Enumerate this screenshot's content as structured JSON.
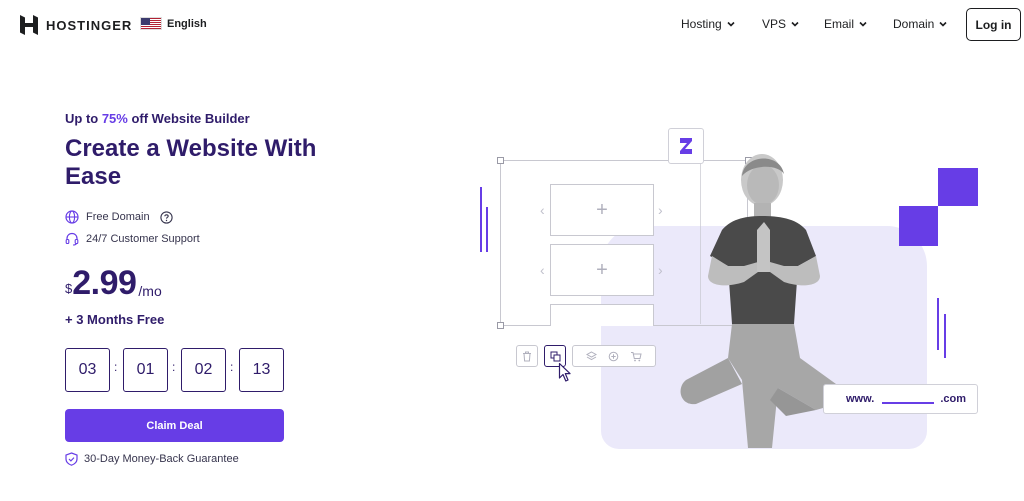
{
  "header": {
    "brand": "HOSTINGER",
    "language": "English",
    "nav": [
      {
        "label": "Hosting"
      },
      {
        "label": "VPS"
      },
      {
        "label": "Email"
      },
      {
        "label": "Domain"
      }
    ],
    "login_label": "Log in"
  },
  "hero": {
    "promo_prefix": "Up to ",
    "promo_accent": "75%",
    "promo_suffix": " off Website Builder",
    "headline": "Create a Website With Ease",
    "features": [
      {
        "label": "Free Domain",
        "icon": "globe-icon"
      },
      {
        "label": "24/7 Customer Support",
        "icon": "headset-icon"
      }
    ],
    "price": {
      "currency": "$",
      "amount": "2.99",
      "period": "/mo"
    },
    "bonus": "+ 3 Months Free",
    "countdown": [
      "03",
      "01",
      "02",
      "13"
    ],
    "cta_label": "Claim Deal",
    "guarantee": "30-Day Money-Back Guarantee"
  },
  "illustration": {
    "url_prefix": "www.",
    "url_suffix": ".com"
  },
  "colors": {
    "accent": "#673de6",
    "text_dark": "#2f1c6a",
    "panel_bg": "#ebe9fa"
  }
}
